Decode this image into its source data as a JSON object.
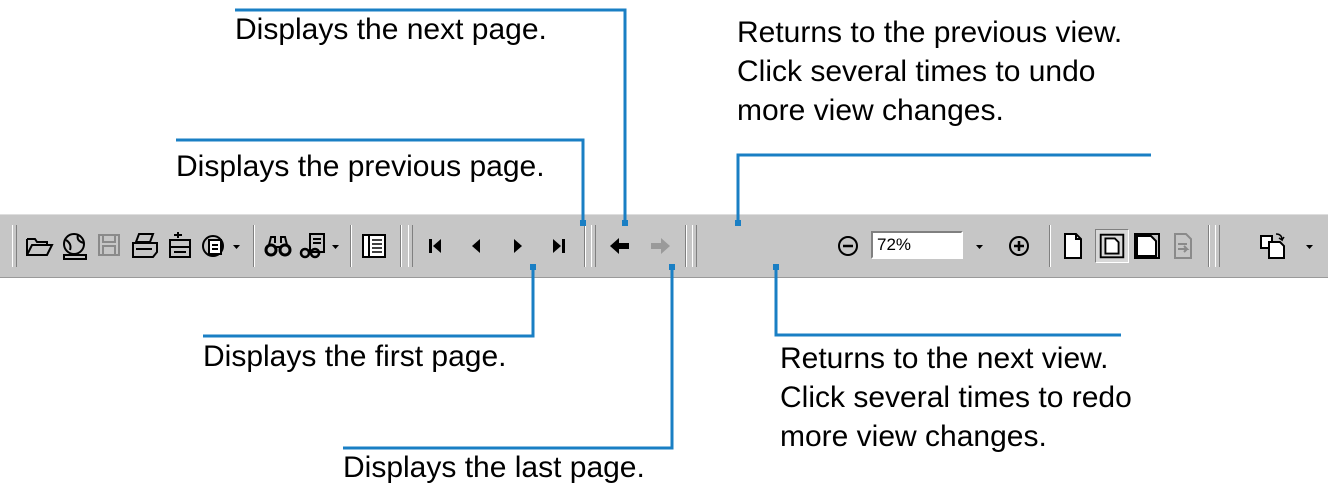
{
  "callouts": {
    "next_page": "Displays the next page.",
    "previous_page": "Displays the previous page.",
    "first_page": "Displays the first page.",
    "last_page": "Displays the last page.",
    "previous_view": [
      "Returns to the previous view.",
      "Click several times to undo",
      "more view changes."
    ],
    "next_view": [
      "Returns to the next view.",
      "Click several times to redo",
      "more view changes."
    ]
  },
  "toolbar": {
    "zoom_value": "72%",
    "buttons": [
      "open-icon",
      "browse-web-icon",
      "save-icon",
      "print-icon",
      "email-icon",
      "web-capture-icon",
      "find-icon",
      "search-icon",
      "show-navigation-pane-icon",
      "first-page-icon",
      "previous-page-icon",
      "next-page-icon",
      "last-page-icon",
      "go-to-previous-view-icon",
      "go-to-next-view-icon",
      "zoom-out-icon",
      "zoom-in-icon",
      "actual-size-icon",
      "fit-page-icon",
      "fit-width-icon",
      "reflow-icon",
      "rotate-view-icon"
    ]
  },
  "colors": {
    "callout_line": "#1a7fc4",
    "toolbar_bg": "#c6c6c6"
  }
}
